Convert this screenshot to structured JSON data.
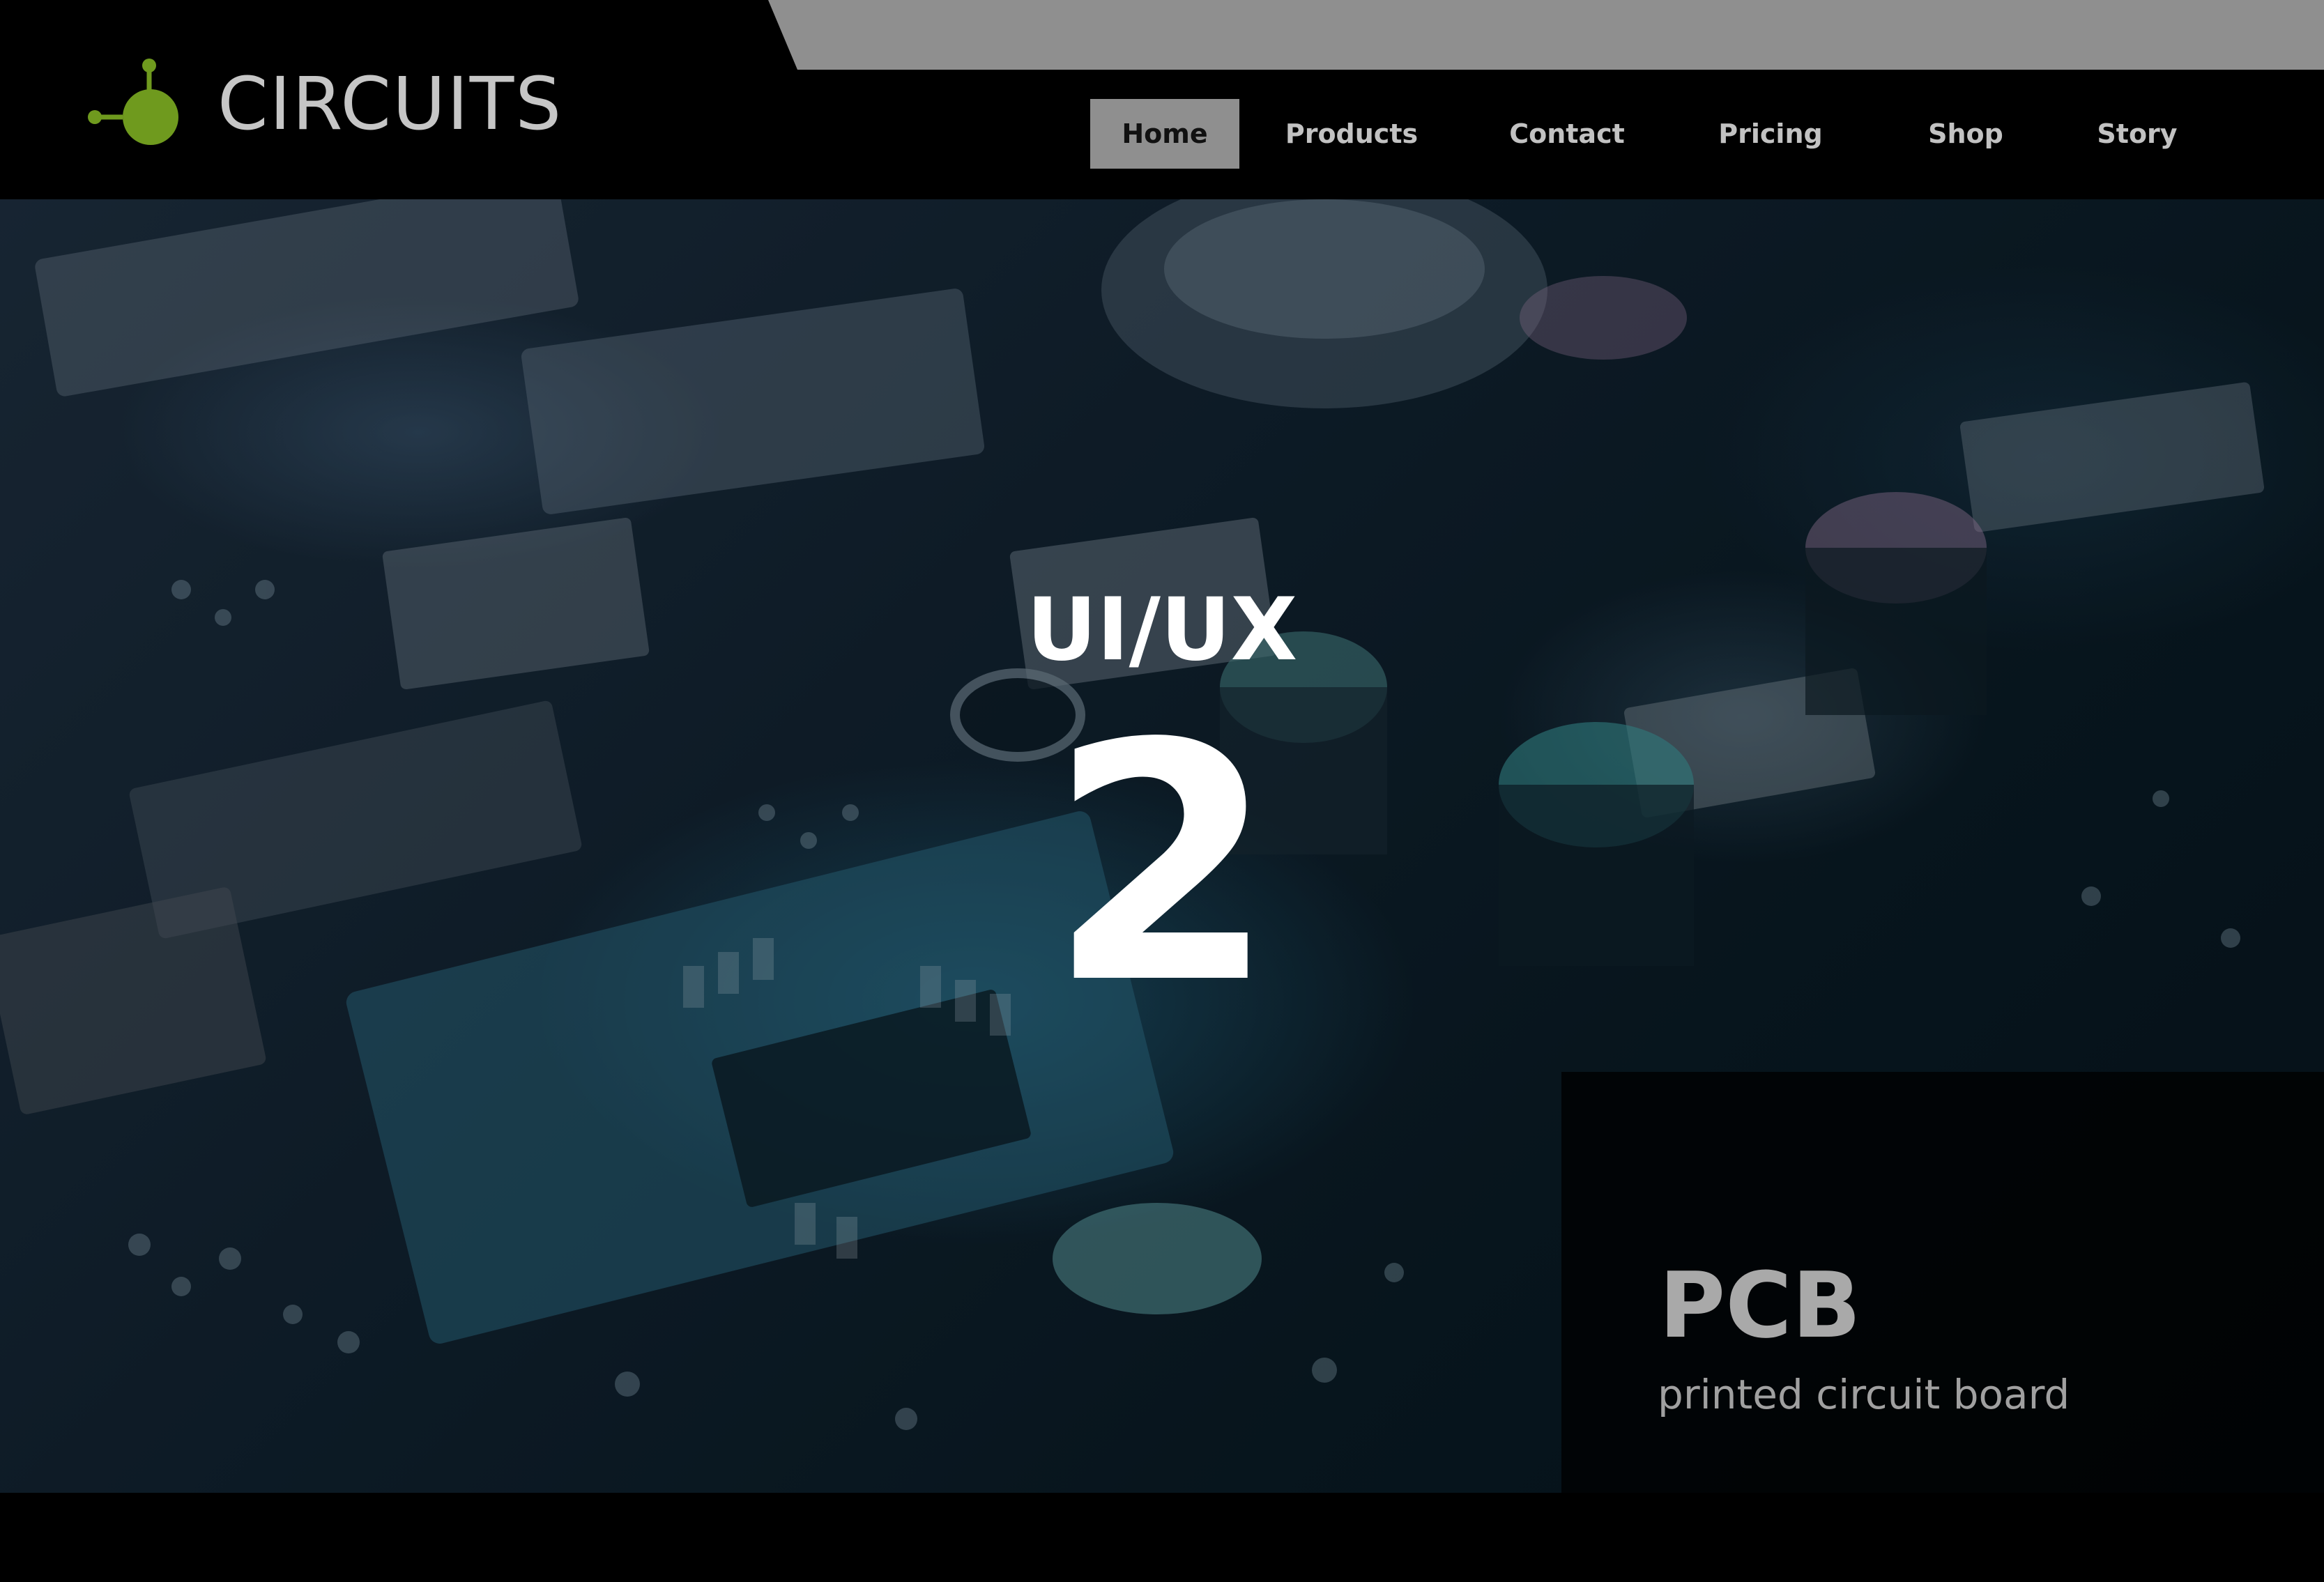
{
  "brand": {
    "name": "CIRCUITS",
    "icon": "circuit-node-icon",
    "accent_color": "#6f9a1e"
  },
  "nav": {
    "items": [
      {
        "label": "Home",
        "active": true
      },
      {
        "label": "Products",
        "active": false
      },
      {
        "label": "Contact",
        "active": false
      },
      {
        "label": "Pricing",
        "active": false
      },
      {
        "label": "Shop",
        "active": false
      },
      {
        "label": "Story",
        "active": false
      }
    ],
    "active_bg": "#8f8f8f"
  },
  "hero": {
    "title": "UI/UX",
    "number": "2",
    "image": "circuit-board-photo"
  },
  "info_panel": {
    "title": "PCB",
    "subtitle": "printed circuit board"
  }
}
